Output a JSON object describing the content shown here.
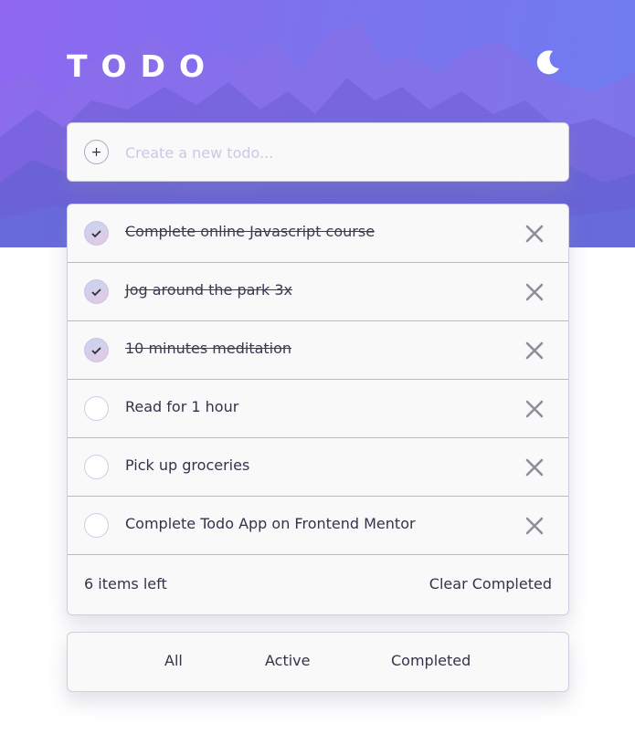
{
  "app": {
    "title": "TODO",
    "theme_icon": "moon-icon"
  },
  "new_todo": {
    "placeholder": "Create a new todo...",
    "value": "",
    "icon": "plus-icon"
  },
  "todos": [
    {
      "text": "Complete online Javascript course",
      "completed": true
    },
    {
      "text": "Jog around the park 3x",
      "completed": true
    },
    {
      "text": "10 minutes meditation",
      "completed": true
    },
    {
      "text": "Read for 1 hour",
      "completed": false
    },
    {
      "text": "Pick up groceries",
      "completed": false
    },
    {
      "text": "Complete Todo App on Frontend Mentor",
      "completed": false
    }
  ],
  "footer": {
    "items_left": "6 items left",
    "clear_label": "Clear Completed"
  },
  "filters": {
    "all": "All",
    "active": "Active",
    "completed": "Completed"
  },
  "colors": {
    "accent_start": "#8f67f0",
    "accent_end": "#6f7cf0",
    "card_bg": "#f9f9fa",
    "text": "#33334a"
  }
}
